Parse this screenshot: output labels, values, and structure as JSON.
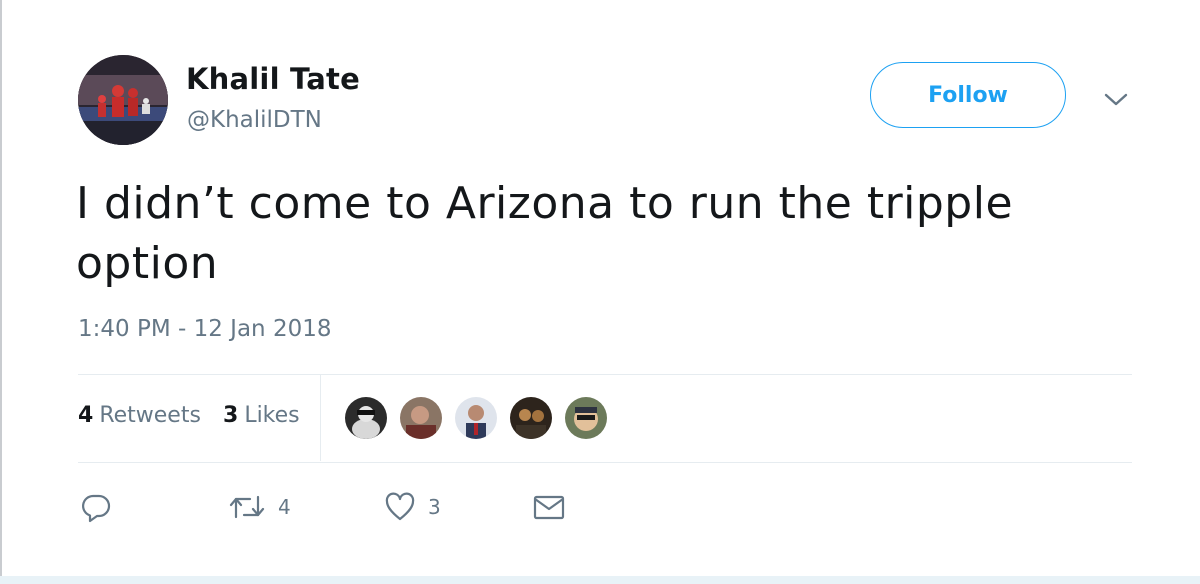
{
  "tweet": {
    "display_name": "Khalil Tate",
    "handle": "@KhalilDTN",
    "follow_label": "Follow",
    "text": "I didn’t come to Arizona to run the tripple option",
    "timestamp": "1:40 PM - 12 Jan 2018",
    "retweets_count": "4",
    "retweets_label": "Retweets",
    "likes_count": "3",
    "likes_label": "Likes",
    "actions": {
      "reply_icon": "reply-icon",
      "retweet_icon": "retweet-icon",
      "retweet_count": "4",
      "like_icon": "heart-icon",
      "like_count": "3",
      "message_icon": "envelope-icon"
    }
  },
  "colors": {
    "accent": "#1da1f2",
    "text_primary": "#14171a",
    "text_secondary": "#657786",
    "divider": "#e6ecf0"
  }
}
